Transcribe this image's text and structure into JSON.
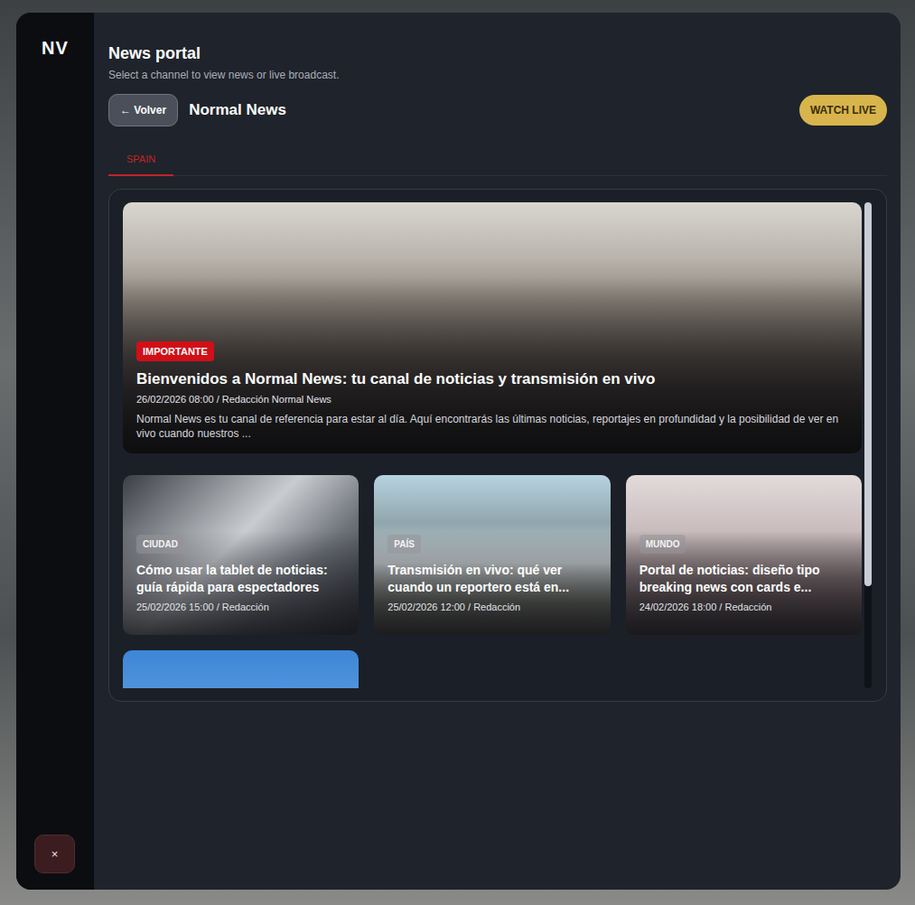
{
  "sidebar": {
    "logo": "NV",
    "close": "×"
  },
  "header": {
    "title": "News portal",
    "subtitle": "Select a channel to view news or live broadcast."
  },
  "channel": {
    "back": "← Volver",
    "name": "Normal News",
    "live": "WATCH LIVE"
  },
  "tabs": [
    {
      "label": "SPAIN",
      "selected": true
    }
  ],
  "featured": {
    "category": "IMPORTANTE",
    "title": "Bienvenidos a Normal News: tu canal de noticias y transmisión en vivo",
    "meta": "26/02/2026 08:00 / Redacción Normal News",
    "excerpt": "Normal News es tu canal de referencia para estar al día. Aquí encontrarás las últimas noticias, reportajes en profundidad y la posibilidad de ver en vivo cuando nuestros ..."
  },
  "cards": [
    {
      "kind": "full",
      "category": "CIUDAD",
      "title": "Cómo usar la tablet de noticias: guía rápida para espectadores",
      "meta": "25/02/2026 15:00 / Redacción"
    },
    {
      "kind": "full",
      "category": "PAÍS",
      "title": "Transmisión en vivo: qué ver cuando un reportero está en...",
      "meta": "25/02/2026 12:00 / Redacción"
    },
    {
      "kind": "full",
      "category": "MUNDO",
      "title": "Portal de noticias: diseño tipo breaking news con cards e...",
      "meta": "24/02/2026 18:00 / Redacción"
    },
    {
      "kind": "clipped"
    }
  ],
  "scrollbar": {
    "level": 0.79
  }
}
